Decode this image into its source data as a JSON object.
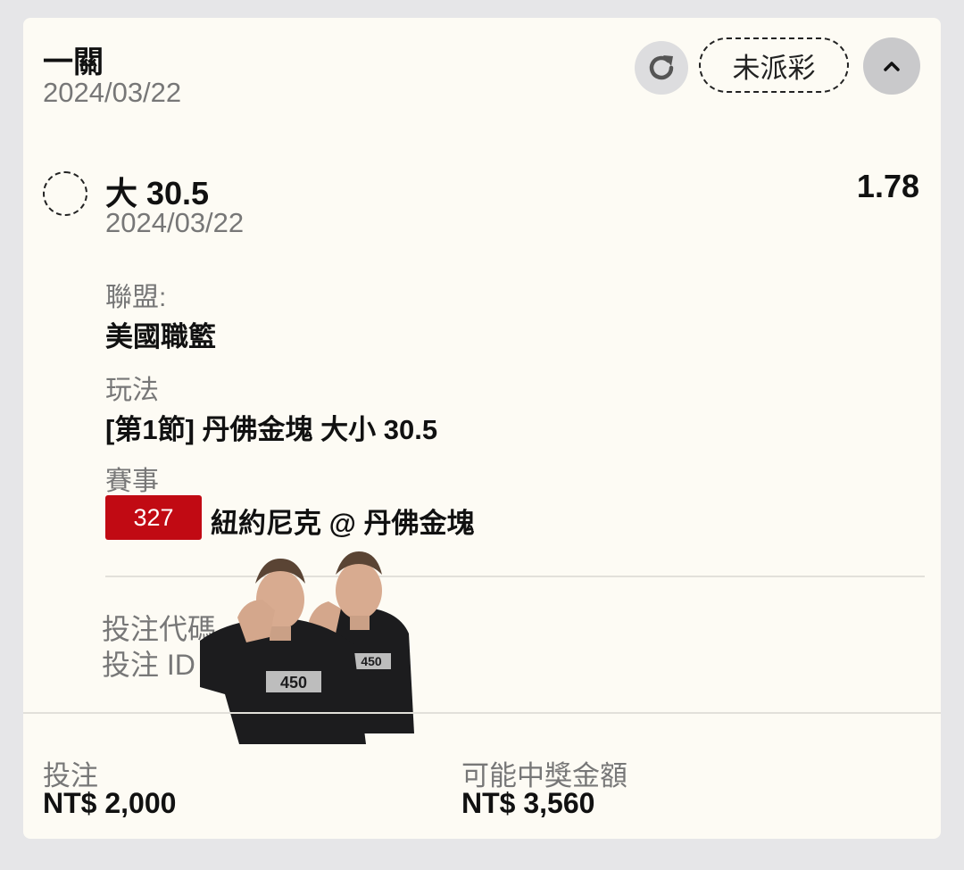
{
  "header": {
    "title": "一關",
    "date": "2024/03/22",
    "status_label": "未派彩"
  },
  "selection": {
    "title": "大 30.5",
    "odds": "1.78",
    "date": "2024/03/22",
    "league_label": "聯盟:",
    "league_value": "美國職籃",
    "bet_type_label": "玩法",
    "bet_type_value": "[第1節] 丹佛金塊 大小 30.5",
    "event_label": "賽事",
    "event_badge": "327",
    "event_name": "紐約尼克 @ 丹佛金塊",
    "bet_code_label": "投注代碼",
    "bet_id_label": "投注 ID"
  },
  "footer": {
    "stake_label": "投注",
    "stake_value": "NT$ 2,000",
    "payout_label": "可能中獎金額",
    "payout_value": "NT$ 3,560"
  },
  "sticker": {
    "shirt_text": "450"
  },
  "colors": {
    "card_bg": "#fdfbf4",
    "badge_red": "#c10a13",
    "page_bg": "#e6e6e8"
  },
  "icons": [
    "refresh-icon",
    "chevron-up-icon",
    "pending-circle-icon"
  ]
}
